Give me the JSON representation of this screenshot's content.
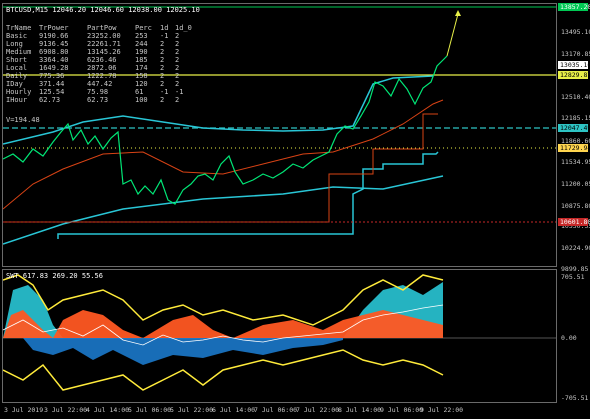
{
  "chart": {
    "header": "BTCUSD,M15  12046.20 12046.60 12038.00 12025.10",
    "sub_header": "SWT 617.83 269.20 55.56",
    "v_label": "V=194.48"
  },
  "table": {
    "headers": [
      "TrName",
      "TrPower",
      "PartPow",
      "Perc",
      "1d",
      "1d_0"
    ],
    "rows": [
      [
        "Basic",
        "9190.66",
        "23252.00",
        "253",
        "-1",
        "2"
      ],
      [
        "Long",
        "9136.45",
        "22261.71",
        "244",
        "2",
        "2"
      ],
      [
        "Medium",
        "6908.80",
        "13145.26",
        "190",
        "2",
        "2"
      ],
      [
        "Short",
        "3364.40",
        "6236.46",
        "185",
        "2",
        "2"
      ],
      [
        "Local",
        "1649.28",
        "2872.06",
        "174",
        "2",
        "2"
      ],
      [
        "Daily",
        "775.36",
        "1222.78",
        "158",
        "2",
        "2"
      ],
      [
        "IDay",
        "371.44",
        "447.42",
        "120",
        "2",
        "2"
      ],
      [
        "Hourly",
        "125.54",
        "75.98",
        "61",
        "-1",
        "-1"
      ],
      [
        "IHour",
        "62.73",
        "62.73",
        "100",
        "2",
        "2"
      ]
    ]
  },
  "price_axis": [
    "13495.10",
    "13170.85",
    "12510.40",
    "12185.15",
    "11860.60",
    "11534.95",
    "11200.05",
    "10875.80",
    "10550.55",
    "10224.90",
    "9899.85"
  ],
  "price_tags": [
    {
      "value": "13857.20",
      "color": "#ffffff",
      "bg": "#00c853"
    },
    {
      "value": "13035.10",
      "color": "#000000",
      "bg": "#ffffff"
    },
    {
      "value": "12829.87",
      "color": "#000000",
      "bg": "#e8f048"
    },
    {
      "value": "12047.49",
      "color": "#000000",
      "bg": "#2ec4c4"
    },
    {
      "value": "11729.94",
      "color": "#000000",
      "bg": "#ffd54f"
    },
    {
      "value": "10601.80",
      "color": "#ffffff",
      "bg": "#c62828"
    }
  ],
  "sub_axis": [
    "705.51",
    "0.00",
    "-705.51"
  ],
  "time_axis": [
    "3 Jul 2019",
    "3 Jul 22:00",
    "4 Jul 14:00",
    "5 Jul 06:00",
    "5 Jul 22:00",
    "6 Jul 14:00",
    "7 Jul 06:00",
    "7 Jul 22:00",
    "8 Jul 14:00",
    "9 Jul 06:00",
    "9 Jul 22:00"
  ],
  "colors": {
    "bull": "#00e676",
    "cyan": "#29c6d6",
    "red": "#d84315",
    "yellow": "#ffeb3b",
    "blue": "#1e88e5"
  }
}
